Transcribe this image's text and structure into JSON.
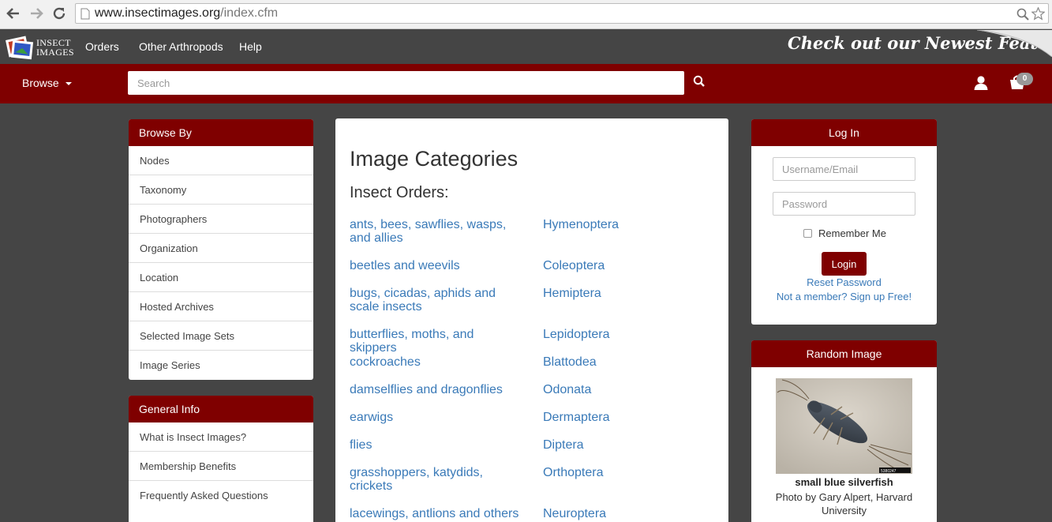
{
  "browser": {
    "url_host": "www.insectimages.org",
    "url_path": "/index.cfm"
  },
  "topnav": {
    "logo_line1": "Insect",
    "logo_line2": "Images",
    "links": [
      "Orders",
      "Other Arthropods",
      "Help"
    ],
    "banner": "Check out our Newest Features"
  },
  "redbar": {
    "browse_label": "Browse",
    "search_placeholder": "Search",
    "cart_count": "0"
  },
  "browse_by": {
    "title": "Browse By",
    "items": [
      "Nodes",
      "Taxonomy",
      "Photographers",
      "Organization",
      "Location",
      "Hosted Archives",
      "Selected Image Sets",
      "Image Series"
    ]
  },
  "general_info": {
    "title": "General Info",
    "items": [
      "What is Insect Images?",
      "Membership Benefits",
      "Frequently Asked Questions"
    ]
  },
  "categories": {
    "title": "Image Categories",
    "subtitle": "Insect Orders:",
    "rows": [
      {
        "common": "ants, bees, sawflies, wasps, and allies",
        "order": "Hymenoptera"
      },
      {
        "common": "beetles and weevils",
        "order": "Coleoptera"
      },
      {
        "common": "bugs, cicadas, aphids and scale insects",
        "order": "Hemiptera"
      },
      {
        "common": "butterflies, moths, and skippers",
        "order": "Lepidoptera"
      },
      {
        "common": "cockroaches",
        "order": "Blattodea"
      },
      {
        "common": "damselflies and dragonflies",
        "order": "Odonata"
      },
      {
        "common": "earwigs",
        "order": "Dermaptera"
      },
      {
        "common": "flies",
        "order": "Diptera"
      },
      {
        "common": "grasshoppers, katydids, crickets",
        "order": "Orthoptera"
      },
      {
        "common": "lacewings, antlions and others",
        "order": "Neuroptera"
      }
    ]
  },
  "login": {
    "title": "Log In",
    "username_placeholder": "Username/Email",
    "password_placeholder": "Password",
    "remember_label": "Remember Me",
    "login_button": "Login",
    "reset_link": "Reset Password",
    "signup_link": "Not a member? Sign up Free!"
  },
  "random_image": {
    "title": "Random Image",
    "image_number": "5380247",
    "caption": "small blue silverfish",
    "credit": "Photo by Gary Alpert, Harvard University"
  },
  "colors": {
    "brand_red": "#7f0000",
    "nav_gray": "#454545",
    "link_blue": "#3a7ab8"
  },
  "icons": [
    "back-arrow-icon",
    "forward-arrow-icon",
    "reload-icon",
    "page-icon",
    "zoom-icon",
    "star-icon",
    "logo-icon",
    "caret-down-icon",
    "search-icon",
    "user-icon",
    "cart-icon",
    "checkbox-icon"
  ]
}
